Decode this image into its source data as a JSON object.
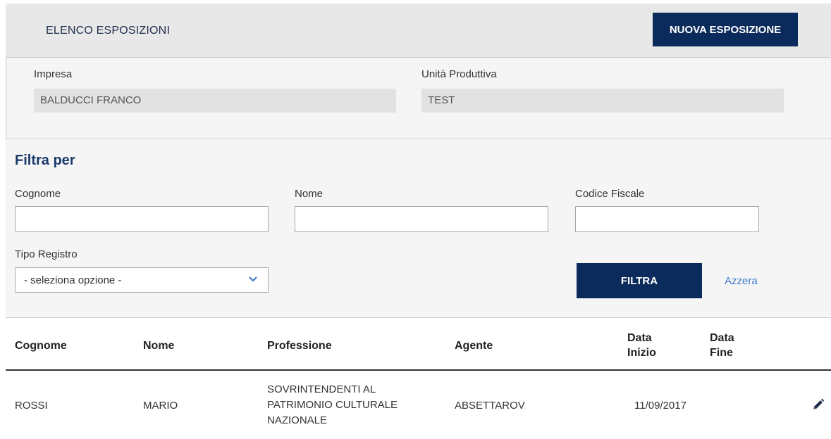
{
  "header": {
    "title": "ELENCO ESPOSIZIONI",
    "new_button": "NUOVA ESPOSIZIONE"
  },
  "company": {
    "impresa_label": "Impresa",
    "impresa_value": "BALDUCCI FRANCO",
    "unita_label": "Unità Produttiva",
    "unita_value": "TEST"
  },
  "filter": {
    "title": "Filtra per",
    "cognome_label": "Cognome",
    "cognome_value": "",
    "nome_label": "Nome",
    "nome_value": "",
    "cf_label": "Codice Fiscale",
    "cf_value": "",
    "tipo_label": "Tipo Registro",
    "tipo_selected": "- seleziona opzione -",
    "filter_button": "FILTRA",
    "reset_link": "Azzera"
  },
  "table": {
    "columns": [
      "Cognome",
      "Nome",
      "Professione",
      "Agente",
      "Data Inizio",
      "Data Fine"
    ],
    "rows": [
      {
        "cognome": "ROSSI",
        "nome": "MARIO",
        "professione": "SOVRINTENDENTI AL PATRIMONIO CULTURALE NAZIONALE",
        "agente": "ABSETTAROV",
        "data_inizio": "11/09/2017",
        "data_fine": "",
        "action_icon": "pencil-icon"
      }
    ]
  },
  "colors": {
    "primary": "#0b2b5c",
    "link": "#3d7ac8",
    "title": "#1a3a6b"
  }
}
